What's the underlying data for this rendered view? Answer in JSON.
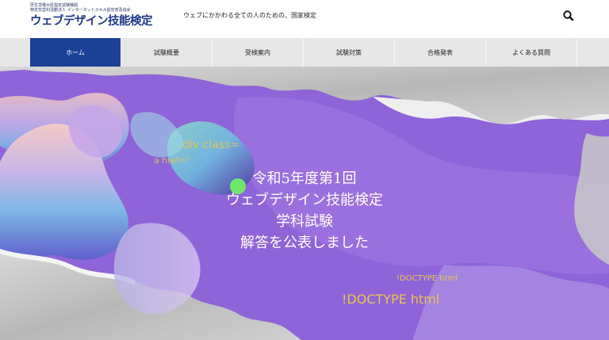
{
  "header": {
    "logo_line1": "厚生労働大臣指定試験機関",
    "logo_line2": "特定非営利活動法人 インターネットスキル認定普及協会",
    "logo_main": "ウェブデザイン技能検定",
    "tagline": "ウェブにかかわる全ての人のための、国家検定",
    "search_icon": "search-icon"
  },
  "nav": {
    "items": [
      {
        "label": "ホーム",
        "active": true
      },
      {
        "label": "試験概要",
        "active": false
      },
      {
        "label": "受検案内",
        "active": false
      },
      {
        "label": "試験対策",
        "active": false
      },
      {
        "label": "合格発表",
        "active": false
      },
      {
        "label": "よくある質問",
        "active": false
      }
    ]
  },
  "hero": {
    "lines": [
      "令和5年度第1回",
      "ウェブデザイン技能検定",
      "学科試験",
      "解答を公表しました"
    ],
    "code_texts": [
      "div class=",
      "a href=\"",
      "!DOCTYPE html",
      "!DOCTYPE html"
    ]
  },
  "colors": {
    "brand": "#1c4295",
    "nav_bg": "#e7e7e7",
    "hero_purple": "#8f64d8",
    "code_yellow": "#e8c54a"
  }
}
